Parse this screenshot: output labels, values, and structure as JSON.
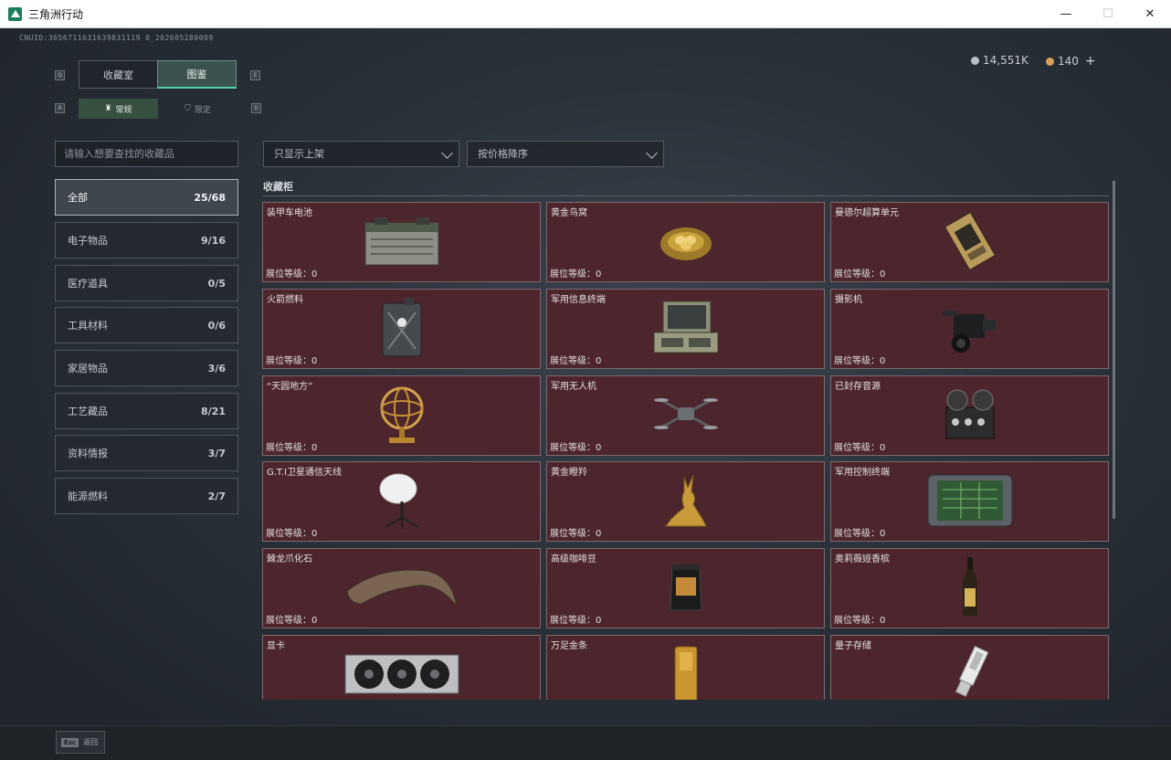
{
  "window": {
    "title": "三角洲行动",
    "minimize": "—",
    "maximize": "☐",
    "close": "✕"
  },
  "uid": "CNUID:3656711631639831119 0_202605280009",
  "currency": [
    {
      "value": "14,551K",
      "color": "#b9c2c8"
    },
    {
      "value": "140",
      "color": "#d8a05a",
      "plus": "+"
    }
  ],
  "key_hints": {
    "main_left": "Q",
    "main_right": "E",
    "sub_left": "A",
    "sub_right": "D"
  },
  "main_tabs": [
    {
      "label": "收藏室",
      "active": false
    },
    {
      "label": "图鉴",
      "active": true
    }
  ],
  "sub_tabs": [
    {
      "label": "常规",
      "icon": "♜",
      "active": true
    },
    {
      "label": "限定",
      "icon": "⛉",
      "active": false
    }
  ],
  "search": {
    "placeholder": "请输入想要查找的收藏品"
  },
  "filters": [
    {
      "label": "只显示上架"
    },
    {
      "label": "按价格降序"
    }
  ],
  "categories": [
    {
      "label": "全部",
      "count": "25/68",
      "active": true
    },
    {
      "label": "电子物品",
      "count": "9/16"
    },
    {
      "label": "医疗道具",
      "count": "0/5"
    },
    {
      "label": "工具材料",
      "count": "0/6"
    },
    {
      "label": "家居物品",
      "count": "3/6"
    },
    {
      "label": "工艺藏品",
      "count": "8/21"
    },
    {
      "label": "资料情报",
      "count": "3/7"
    },
    {
      "label": "能源燃料",
      "count": "2/7"
    }
  ],
  "section_title": "收藏柜",
  "level_label": "展位等级：",
  "items": [
    {
      "name": "装甲车电池",
      "level": "0",
      "icon": "battery-icon"
    },
    {
      "name": "黄金鸟窝",
      "level": "0",
      "icon": "golden-nest-icon"
    },
    {
      "name": "曼德尔超算单元",
      "level": "0",
      "icon": "circuit-board-icon"
    },
    {
      "name": "火箭燃料",
      "level": "0",
      "icon": "fuel-can-icon"
    },
    {
      "name": "军用信息终端",
      "level": "0",
      "icon": "terminal-case-icon"
    },
    {
      "name": "摄影机",
      "level": "0",
      "icon": "camera-icon"
    },
    {
      "name": "“天圆地方”",
      "level": "0",
      "icon": "armillary-icon"
    },
    {
      "name": "军用无人机",
      "level": "0",
      "icon": "drone-icon"
    },
    {
      "name": "已封存音源",
      "level": "0",
      "icon": "reel-recorder-icon"
    },
    {
      "name": "G.T.I卫星通信天线",
      "level": "0",
      "icon": "satellite-dish-icon"
    },
    {
      "name": "黄金瞪羚",
      "level": "0",
      "icon": "golden-gazelle-icon"
    },
    {
      "name": "军用控制终端",
      "level": "0",
      "icon": "control-terminal-icon"
    },
    {
      "name": "棘龙爪化石",
      "level": "0",
      "icon": "claw-fossil-icon"
    },
    {
      "name": "高级咖啡豆",
      "level": "0",
      "icon": "coffee-bag-icon"
    },
    {
      "name": "奥莉薇娅香槟",
      "level": "0",
      "icon": "champagne-icon"
    },
    {
      "name": "显卡",
      "level": "",
      "icon": "gpu-icon"
    },
    {
      "name": "万足金条",
      "level": "",
      "icon": "gold-bar-icon"
    },
    {
      "name": "量子存储",
      "level": "",
      "icon": "quantum-storage-icon"
    }
  ],
  "bottom": {
    "esc_key": "Esc",
    "esc_label": "返回"
  }
}
